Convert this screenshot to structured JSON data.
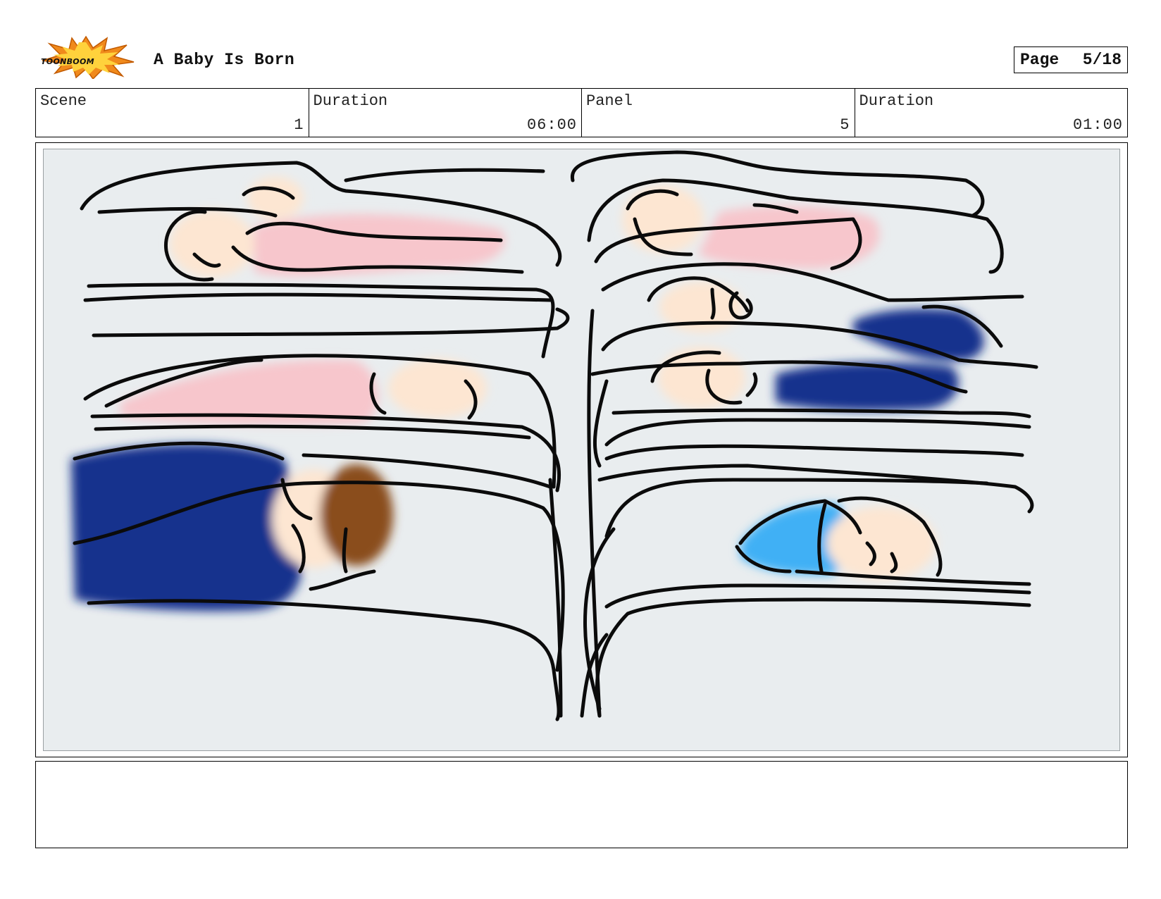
{
  "header": {
    "logo_text": "TOONBOOM",
    "project_title": "A Baby Is Born",
    "page_label": "Page",
    "page_number": "5/18"
  },
  "info": {
    "scene_label": "Scene",
    "scene_value": "1",
    "scene_duration_label": "Duration",
    "scene_duration_value": "06:00",
    "panel_label": "Panel",
    "panel_value": "5",
    "panel_duration_label": "Duration",
    "panel_duration_value": "01:00"
  },
  "panel_image": {
    "subject": "sketch of babies sleeping in hospital bassinets",
    "colors": {
      "background": "#e9edef",
      "pink_blanket": "#f7c6cc",
      "skin": "#fde6d2",
      "navy_blanket": "#14318d",
      "light_blue_blanket": "#3fb0f5",
      "hair": "#8a4d1c",
      "logo_orange": "#f08a1c"
    }
  },
  "action_notes": ""
}
